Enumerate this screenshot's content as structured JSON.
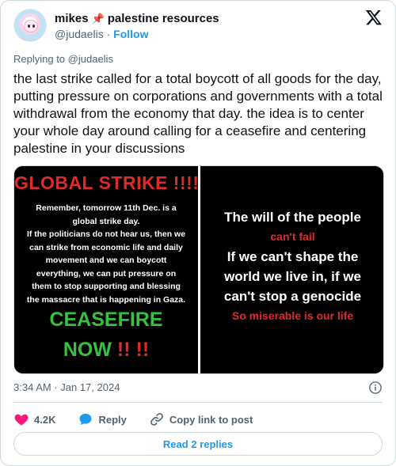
{
  "author": {
    "display_name": "mikes",
    "pin_emoji": "📌",
    "suffix": "palestine resources",
    "handle": "@judaelis",
    "separator": "·",
    "follow_label": "Follow"
  },
  "reply_context": {
    "prefix": "Replying to",
    "handle": "@judaelis"
  },
  "tweet": {
    "text": "the last strike called for a total boycott of all goods for the day, putting pressure on corporations and governments with a total withdrawal from the economy that day. the idea is to center your whole day around calling for a ceasefire and centering palestine in your discussions",
    "timestamp": "3:34 AM · Jan 17, 2024"
  },
  "media": {
    "left": {
      "headline": "GLOBAL STRIKE !!!!",
      "lines": [
        "Remember, tomorrow 11th Dec. is a",
        "global strike day.",
        "If the politicians do not hear us, then we",
        "can strike from economic life and daily",
        "movement and we can boycott",
        "everything, we can put pressure on",
        "them to stop supporting and blessing",
        "the massacre that is happening in Gaza."
      ],
      "ceasefire": "CEASEFIRE",
      "now": "NOW",
      "bangs": "!! !!"
    },
    "right": {
      "line1": "The will of the people",
      "line2": "can't fail",
      "line3": "If we can't shape the",
      "line4": "world we live in, if we",
      "line5": "can't stop a genocide",
      "line6": "So miserable is our life"
    }
  },
  "actions": {
    "like_count": "4.2K",
    "reply_label": "Reply",
    "copy_label": "Copy link to post"
  },
  "read_replies_label": "Read 2 replies",
  "colors": {
    "link_blue": "#1d9bf0",
    "heart_pink": "#f91880",
    "strike_red": "#e02a2a",
    "ceasefire_green": "#35c23c"
  },
  "icons": [
    "x-logo-icon",
    "info-icon",
    "heart-icon",
    "reply-bubble-icon",
    "link-icon",
    "pin-icon"
  ]
}
